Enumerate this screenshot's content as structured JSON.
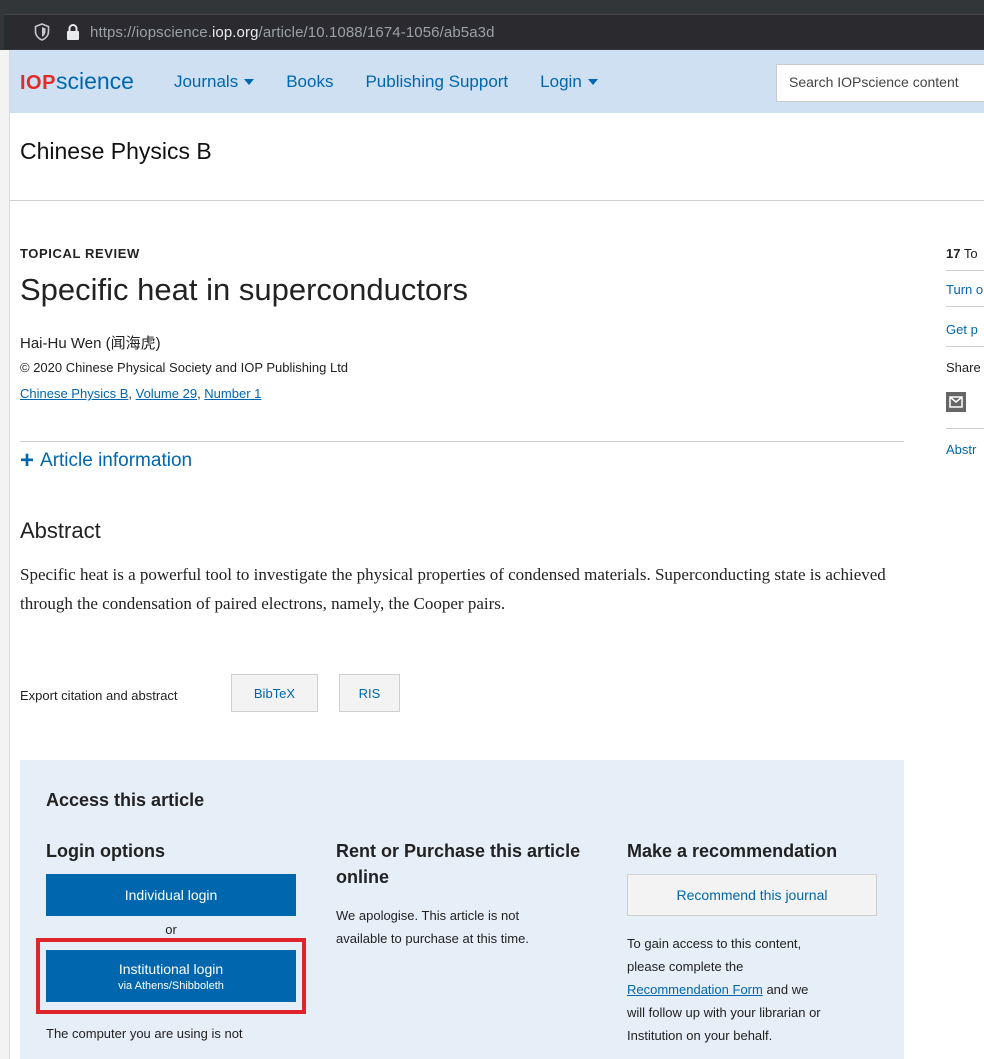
{
  "browser": {
    "url_prefix": "https://iopscience.",
    "url_domain": "iop.org",
    "url_path": "/article/10.1088/1674-1056/ab5a3d"
  },
  "header": {
    "logo_iop": "IOP",
    "logo_science": "science",
    "nav": [
      {
        "label": "Journals",
        "has_caret": true
      },
      {
        "label": "Books",
        "has_caret": false
      },
      {
        "label": "Publishing Support",
        "has_caret": false
      },
      {
        "label": "Login",
        "has_caret": true
      }
    ],
    "search_placeholder": "Search IOPscience content"
  },
  "journal": "Chinese Physics B",
  "article": {
    "type_label": "TOPICAL REVIEW",
    "title": "Specific heat in superconductors",
    "author": "Hai-Hu Wen (闻海虎)",
    "copyright": "© 2020 Chinese Physical Society and IOP Publishing Ltd",
    "citation": {
      "journal_link": "Chinese Physics B",
      "sep1": ", ",
      "volume_link": "Volume 29",
      "sep2": ", ",
      "number_link": "Number 1"
    },
    "article_info_label": "Article information"
  },
  "abstract": {
    "heading": "Abstract",
    "text": "Specific heat is a powerful tool to investigate the physical properties of condensed materials. Superconducting state is achieved through the condensation of paired electrons, namely, the Cooper pairs."
  },
  "export": {
    "label": "Export citation and abstract",
    "bibtex": "BibTeX",
    "ris": "RIS"
  },
  "access": {
    "heading": "Access this article",
    "login": {
      "heading": "Login options",
      "individual": "Individual login",
      "or": "or",
      "institutional": "Institutional login",
      "institutional_sub": "via Athens/Shibboleth",
      "note": "The computer you are using is not"
    },
    "purchase": {
      "heading_line1": "Rent or Purchase this article",
      "heading_line2": "online",
      "text_line1": "We apologise. This article is not",
      "text_line2": "available to purchase at this time."
    },
    "recommend": {
      "heading": "Make a recommendation",
      "button": "Recommend this journal",
      "text1": "To gain access to this content,",
      "text2": "please complete the",
      "link": "Recommendation Form",
      "text3": " and we",
      "text4": "will follow up with your librarian or",
      "text5": "Institution on your behalf."
    }
  },
  "sidebar": {
    "count": "17",
    "count_label": "To",
    "link1": "Turn o",
    "link2": "Get p",
    "share": "Share",
    "abstract_link": "Abstr"
  }
}
